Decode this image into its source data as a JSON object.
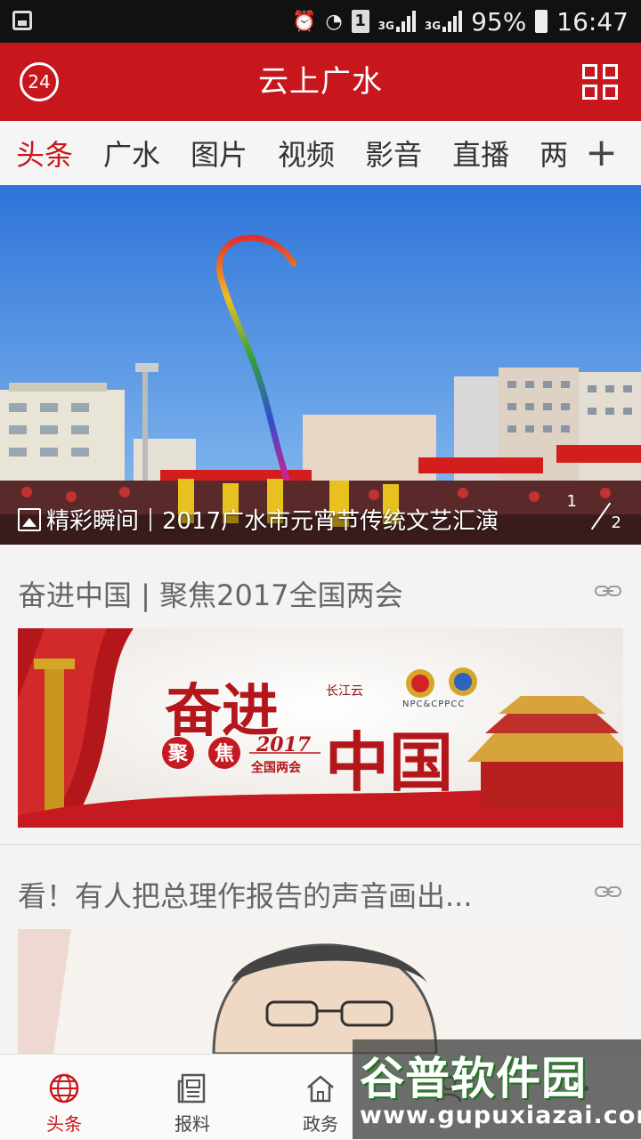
{
  "status_bar": {
    "battery": "95%",
    "time": "16:47",
    "sim_slot": "1",
    "network_1": "3G",
    "network_2": "3G"
  },
  "app_bar": {
    "title": "云上广水",
    "left_badge": "24"
  },
  "tabs": [
    "头条",
    "广水",
    "图片",
    "视频",
    "影音",
    "直播",
    "两"
  ],
  "hero": {
    "caption_prefix": "精彩瞬间",
    "caption_title": "2017广水市元宵节传统文艺汇演",
    "page_current": "1",
    "page_total": "2"
  },
  "cards": [
    {
      "title": "奋进中国 | 聚焦2017全国两会",
      "banner": {
        "headline_1": "奋进",
        "headline_2": "中国",
        "sub_1": "聚",
        "sub_2": "焦",
        "year": "2017",
        "sub_3": "全国两会",
        "logo": "长江云",
        "emblem_text": "NPC&CPPCC"
      }
    },
    {
      "title": "看！有人把总理作报告的声音画出..."
    }
  ],
  "bottom_nav": [
    {
      "label": "头条",
      "icon": "globe-icon"
    },
    {
      "label": "报料",
      "icon": "newspaper-icon"
    },
    {
      "label": "政务",
      "icon": "home-icon"
    },
    {
      "label": "",
      "icon": "profile-icon"
    },
    {
      "label": "",
      "icon": "more-icon"
    }
  ],
  "watermark": {
    "brand": "谷普软件园",
    "url": "www.gupuxiazai.com"
  },
  "colors": {
    "brand_red": "#c8161d",
    "status_bar": "#111111",
    "text_gray": "#666666"
  }
}
